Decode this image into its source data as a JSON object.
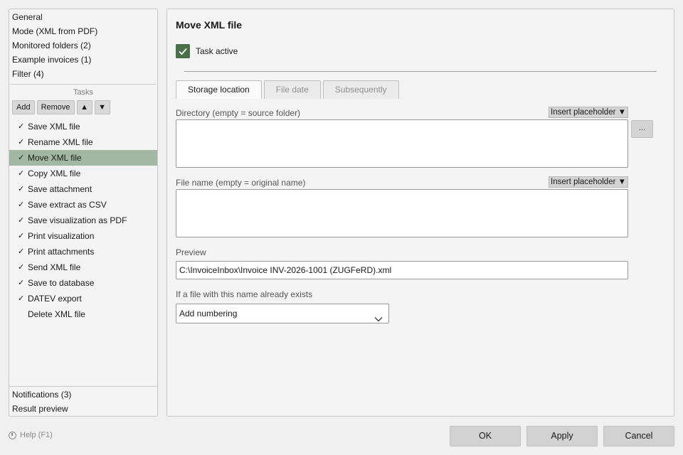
{
  "sidebar": {
    "top_items": [
      {
        "label": "General"
      },
      {
        "label": "Mode (XML from PDF)"
      },
      {
        "label": "Monitored folders (2)"
      },
      {
        "label": "Example invoices (1)"
      },
      {
        "label": "Filter (4)"
      }
    ],
    "tasks_header": "Tasks",
    "toolbar": {
      "add": "Add",
      "remove": "Remove",
      "up": "▲",
      "down": "▼"
    },
    "tasks": [
      {
        "label": "Save XML file",
        "check": "✓"
      },
      {
        "label": "Rename XML file",
        "check": "✓"
      },
      {
        "label": "Move XML file",
        "check": "✓"
      },
      {
        "label": "Copy XML file",
        "check": "✓"
      },
      {
        "label": "Save attachment",
        "check": "✓"
      },
      {
        "label": "Save extract as CSV",
        "check": "✓"
      },
      {
        "label": "Save visualization as PDF",
        "check": "✓"
      },
      {
        "label": "Print visualization",
        "check": "✓"
      },
      {
        "label": "Print attachments",
        "check": "✓"
      },
      {
        "label": "Send XML file",
        "check": "✓"
      },
      {
        "label": "Save to database",
        "check": "✓"
      },
      {
        "label": "DATEV export",
        "check": "✓"
      },
      {
        "label": "Delete XML file",
        "check": ""
      }
    ],
    "selected_task": "Move XML file",
    "bottom_items": [
      {
        "label": "Notifications (3)"
      },
      {
        "label": "Result preview"
      }
    ]
  },
  "main": {
    "title": "Move XML file",
    "task_active_label": "Task active",
    "task_active_checked": true,
    "tabs": [
      {
        "label": "Storage location",
        "active": true
      },
      {
        "label": "File date",
        "active": false
      },
      {
        "label": "Subsequently",
        "active": false
      }
    ],
    "directory_label": "Directory (empty = source folder)",
    "directory_value": "",
    "insert_placeholder": "Insert placeholder ▼",
    "browse_label": "...",
    "filename_label": "File name (empty = original name)",
    "filename_value": "",
    "preview_label": "Preview",
    "preview_value": "C:\\InvoiceInbox\\Invoice INV-2026-1001 (ZUGFeRD).xml",
    "exists_label": "If a file with this name already exists",
    "exists_value": "Add numbering"
  },
  "footer": {
    "help": "Help (F1)",
    "ok": "OK",
    "apply": "Apply",
    "cancel": "Cancel"
  },
  "colors": {
    "selection": "#a3b8a3",
    "checkbox": "#4a704a"
  }
}
